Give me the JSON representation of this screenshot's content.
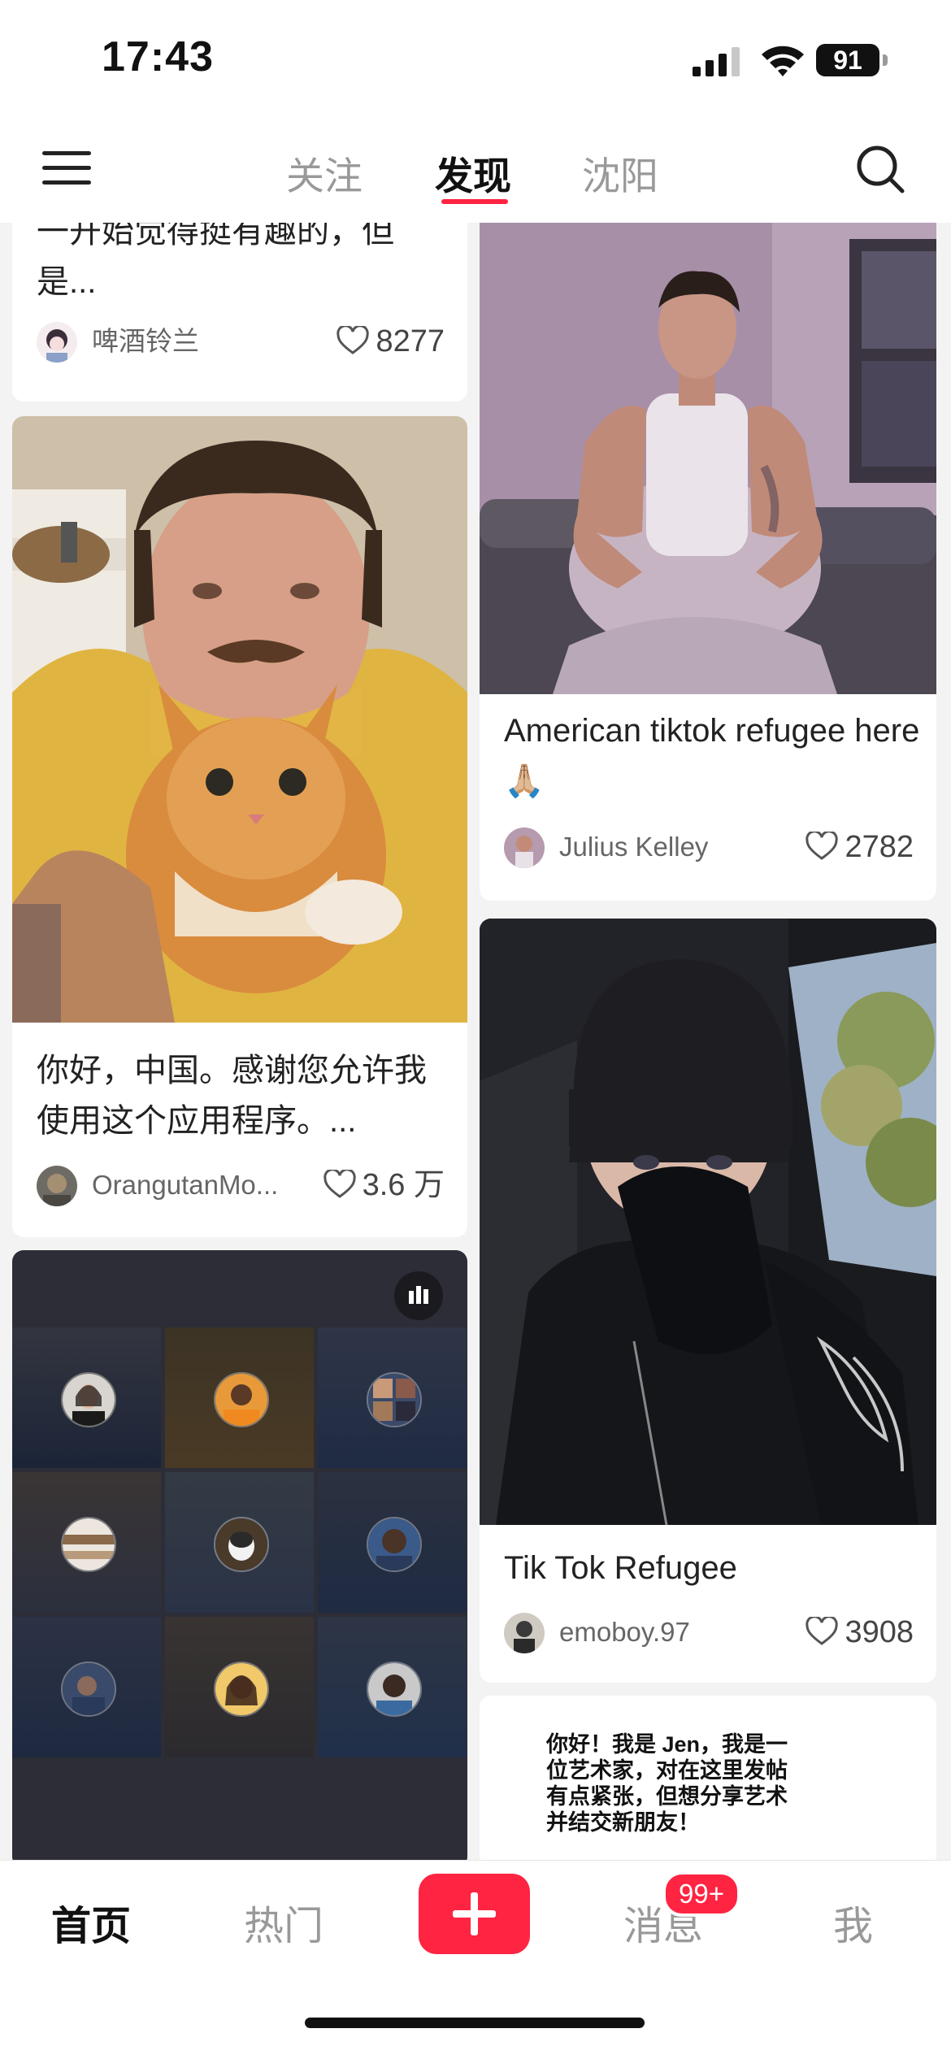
{
  "status_bar": {
    "time": "17:43",
    "battery": "91"
  },
  "top_nav": {
    "tabs": [
      {
        "label": "关注",
        "active": false
      },
      {
        "label": "发现",
        "active": true
      },
      {
        "label": "沈阳",
        "active": false
      }
    ],
    "menu_icon": "hamburger-menu-icon",
    "search_icon": "search-icon"
  },
  "feed": {
    "left": [
      {
        "title": "一开始觉得挺有趣的，但是...",
        "author": "啤酒铃兰",
        "likes": "8277"
      },
      {
        "title": "你好，中国。感谢您允许我使用这个应用程序。...",
        "author": "OrangutanMo...",
        "likes": "3.6 万"
      },
      {
        "type": "video-call-grid",
        "icon": "audio-bars-icon",
        "participants": 9
      }
    ],
    "right": [
      {
        "title": "American tiktok refugee here🙏🏼",
        "author": "Julius Kelley",
        "likes": "2782"
      },
      {
        "title": "Tik Tok Refugee",
        "author": "emoboy.97",
        "likes": "3908"
      },
      {
        "text_card": "你好！我是 Jen，我是一位艺术家，对在这里发帖有点紧张，但想分享艺术并结交新朋友！"
      }
    ]
  },
  "bottom_nav": {
    "tabs": [
      {
        "label": "首页",
        "active": true
      },
      {
        "label": "热门",
        "active": false
      },
      {
        "label": "消息",
        "active": false
      },
      {
        "label": "我",
        "active": false
      }
    ],
    "publish_icon": "plus-icon",
    "messages_badge": "99+"
  },
  "colors": {
    "accent": "#ff2442",
    "background": "#f3f3f3"
  }
}
